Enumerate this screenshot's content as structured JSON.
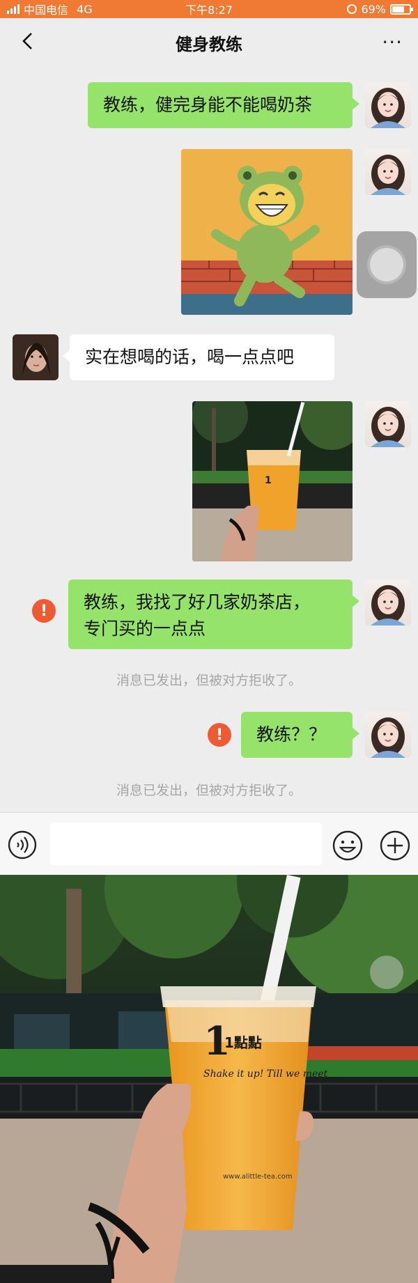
{
  "status_bar": {
    "carrier": "中国电信",
    "network": "4G",
    "time": "下午8:27",
    "battery": "69%"
  },
  "nav": {
    "title": "健身教练",
    "more": "···"
  },
  "messages": {
    "m1": "教练，健完身能不能喝奶茶",
    "m2": "实在想喝的话，喝一点点吧",
    "m3_line1": "教练，我找了好几家奶茶店，",
    "m3_line2": "专门买的一点点",
    "m4": "教练？？",
    "warn_mark": "!"
  },
  "system": {
    "rejected_1": "消息已发出，但被对方拒收了。",
    "rejected_2": "消息已发出，但被对方拒收了。"
  },
  "cup": {
    "brand": "1點點",
    "slogan": "Shake it up! Till we meet",
    "url": "www.alittle-tea.com"
  },
  "icons": [
    "back-icon",
    "more-icon",
    "voice-icon",
    "emoji-icon",
    "plus-icon",
    "warning-icon"
  ],
  "colors": {
    "status_bar": "#f07a33",
    "sent_bubble": "#95e36a",
    "received_bubble": "#ffffff",
    "warning": "#ee5a32",
    "chat_bg": "#ededed"
  }
}
